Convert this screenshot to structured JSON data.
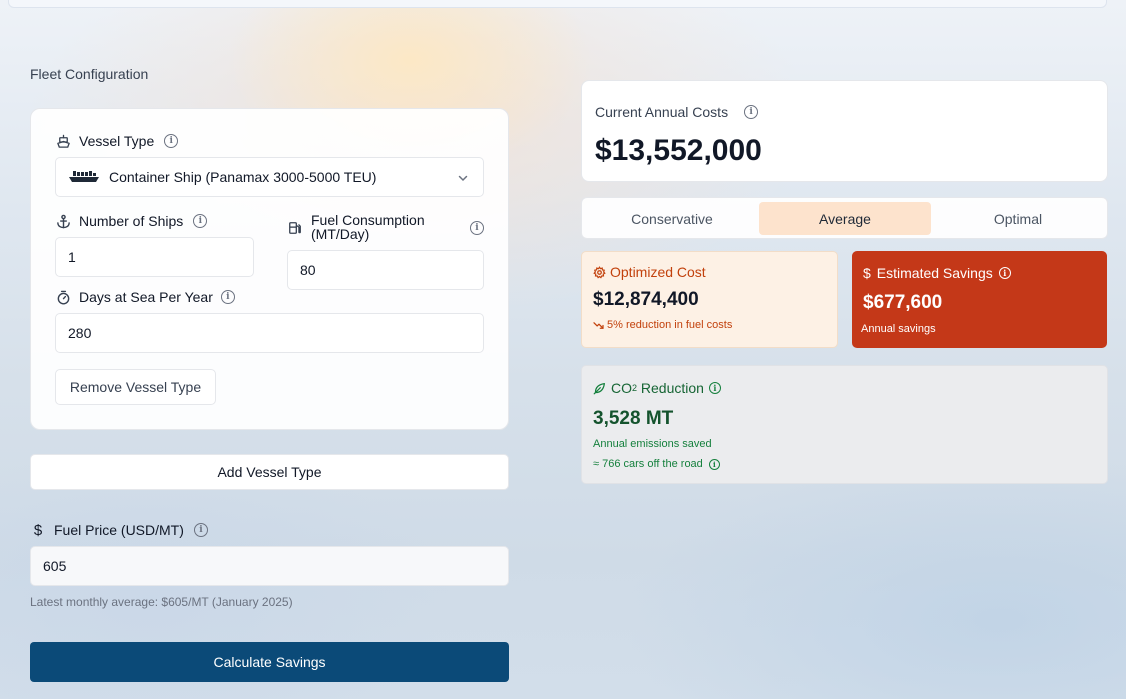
{
  "section_title": "Fleet Configuration",
  "vessel": {
    "type_label": "Vessel Type",
    "type_value": "Container Ship (Panamax 3000-5000 TEU)",
    "ships_label": "Number of Ships",
    "ships_value": "1",
    "fuel_label_line1": "Fuel Consumption",
    "fuel_label_line2": "(MT/Day)",
    "fuel_value": "80",
    "days_label": "Days at Sea Per Year",
    "days_value": "280",
    "remove_label": "Remove Vessel Type"
  },
  "add_vessel_label": "Add Vessel Type",
  "fuel_price": {
    "label": "Fuel Price (USD/MT)",
    "value": "605",
    "help": "Latest monthly average: $605/MT (January 2025)"
  },
  "calculate_label": "Calculate Savings",
  "current_costs": {
    "label": "Current Annual Costs",
    "value": "$13,552,000"
  },
  "tabs": [
    "Conservative",
    "Average",
    "Optimal"
  ],
  "active_tab": "Average",
  "optimized": {
    "label": "Optimized Cost",
    "value": "$12,874,400",
    "note": "5% reduction in fuel costs"
  },
  "savings": {
    "label": "Estimated Savings",
    "value": "$677,600",
    "note": "Annual savings"
  },
  "co2": {
    "label_prefix": "CO",
    "label_sub": "2",
    "label_suffix": " Reduction",
    "value": "3,528 MT",
    "note": "Annual emissions saved",
    "cars": "≈ 766 cars off the road"
  },
  "colors": {
    "primary_button": "#0b4a78",
    "savings_card": "#c43818",
    "optimized_card": "#fdf1e5",
    "active_tab": "#fde3cd",
    "co2_accent": "#15803d",
    "optimized_accent": "#c2410c"
  }
}
